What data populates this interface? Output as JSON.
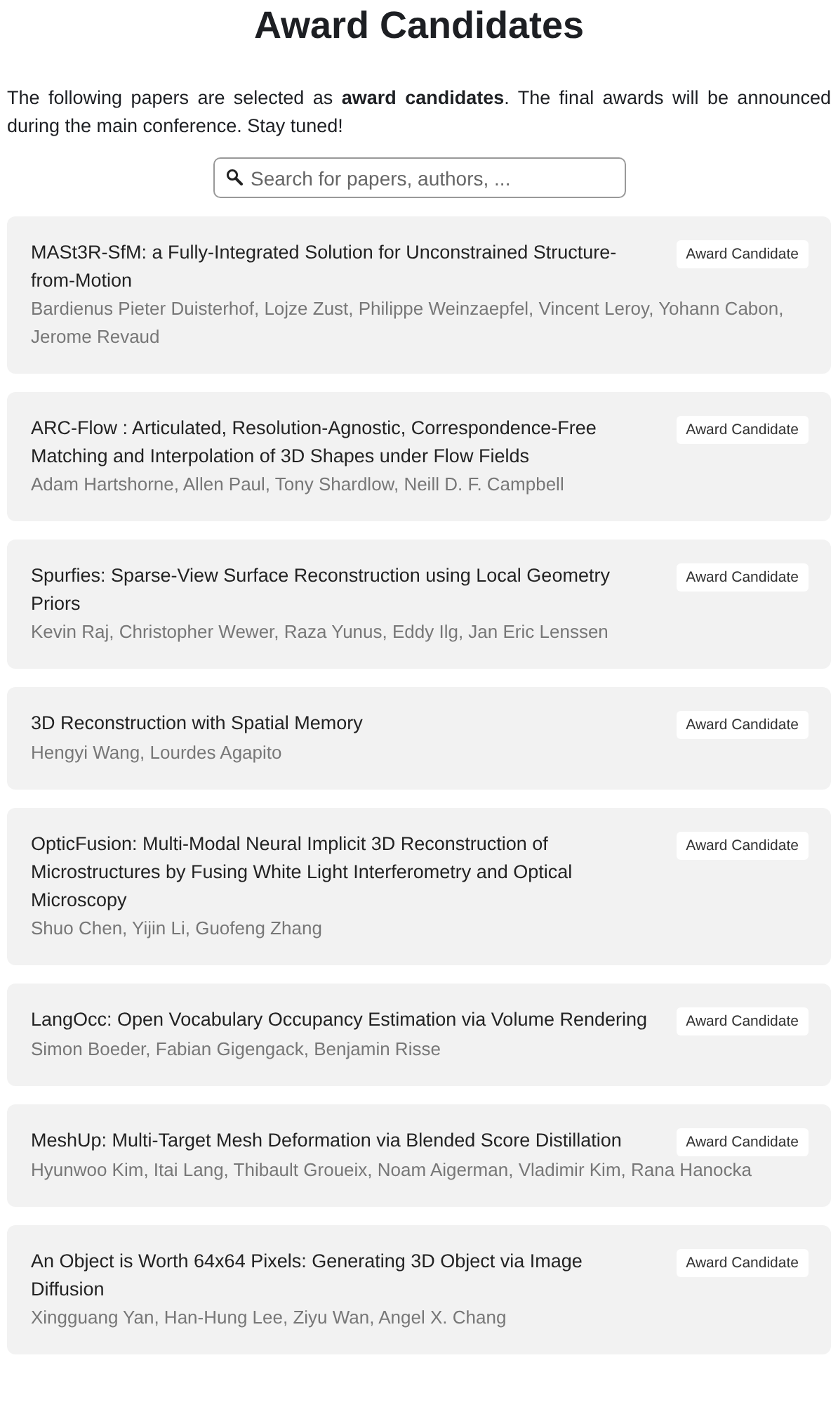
{
  "title": "Award Candidates",
  "intro": "The following papers are selected as **award candidates**. The final awards will be announced during the main conference. Stay tuned!",
  "search": {
    "placeholder": "Search for papers, authors, ..."
  },
  "papers": [
    {
      "title": "MASt3R-SfM: a Fully-Integrated Solution for Unconstrained Structure-from-Motion",
      "authors": "Bardienus Pieter Duisterhof, Lojze Zust, Philippe Weinzaepfel, Vincent Leroy, Yohann Cabon, Jerome Revaud",
      "badge": "Award Candidate"
    },
    {
      "title": "ARC-Flow : Articulated, Resolution-Agnostic, Correspondence-Free Matching and Interpolation of 3D Shapes under Flow Fields",
      "authors": "Adam Hartshorne, Allen Paul, Tony Shardlow, Neill D. F. Campbell",
      "badge": "Award Candidate"
    },
    {
      "title": "Spurfies: Sparse-View Surface Reconstruction using Local Geometry Priors",
      "authors": "Kevin Raj, Christopher Wewer, Raza Yunus, Eddy Ilg, Jan Eric Lenssen",
      "badge": "Award Candidate"
    },
    {
      "title": "3D Reconstruction with Spatial Memory",
      "authors": "Hengyi Wang, Lourdes Agapito",
      "badge": "Award Candidate"
    },
    {
      "title": "OpticFusion: Multi-Modal Neural Implicit 3D Reconstruction of Microstructures by Fusing White Light Interferometry and Optical Microscopy",
      "authors": "Shuo Chen, Yijin Li, Guofeng Zhang",
      "badge": "Award Candidate"
    },
    {
      "title": "LangOcc: Open Vocabulary Occupancy Estimation via Volume Rendering",
      "authors": "Simon Boeder, Fabian Gigengack, Benjamin Risse",
      "badge": "Award Candidate"
    },
    {
      "title": "MeshUp: Multi-Target Mesh Deformation via Blended Score Distillation",
      "authors": "Hyunwoo Kim, Itai Lang, Thibault Groueix, Noam Aigerman, Vladimir Kim, Rana Hanocka",
      "badge": "Award Candidate"
    },
    {
      "title": "An Object is Worth 64x64 Pixels: Generating 3D Object via Image Diffusion",
      "authors": "Xingguang Yan, Han-Hung Lee, Ziyu Wan, Angel X. Chang",
      "badge": "Award Candidate"
    }
  ]
}
